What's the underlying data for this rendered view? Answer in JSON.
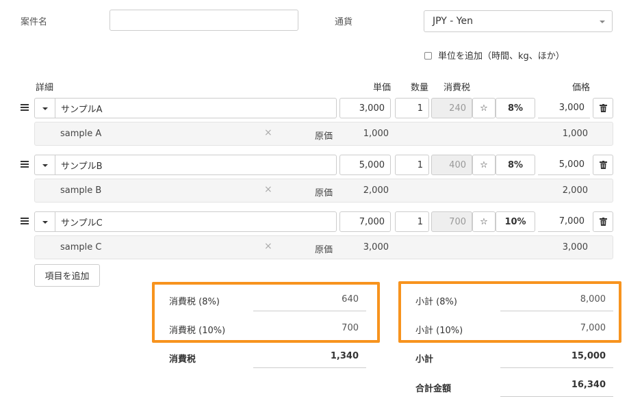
{
  "form": {
    "project_name_label": "案件名",
    "project_name_value": "",
    "currency_label": "通貨",
    "currency_value": "JPY - Yen",
    "unit_checkbox_label": "単位を追加（時間、kg、ほか）"
  },
  "table": {
    "headers": {
      "detail": "詳細",
      "unit_price": "単価",
      "qty": "数量",
      "tax": "消費税",
      "price": "価格"
    },
    "cost_label": "原価",
    "rows": [
      {
        "name": "サンプルA",
        "unit_price": "3,000",
        "qty": "1",
        "tax": "240",
        "tax_rate": "8%",
        "price": "3,000",
        "note": "sample A",
        "cost": "1,000",
        "cost_price": "1,000"
      },
      {
        "name": "サンプルB",
        "unit_price": "5,000",
        "qty": "1",
        "tax": "400",
        "tax_rate": "8%",
        "price": "5,000",
        "note": "sample B",
        "cost": "2,000",
        "cost_price": "2,000"
      },
      {
        "name": "サンプルC",
        "unit_price": "7,000",
        "qty": "1",
        "tax": "700",
        "tax_rate": "10%",
        "price": "7,000",
        "note": "sample C",
        "cost": "3,000",
        "cost_price": "3,000"
      }
    ],
    "add_item_label": "項目を追加"
  },
  "totals": {
    "tax8_label": "消費税 (8%)",
    "tax8_value": "640",
    "tax10_label": "消費税 (10%)",
    "tax10_value": "700",
    "tax_total_label": "消費税",
    "tax_total_value": "1,340",
    "sub8_label": "小計 (8%)",
    "sub8_value": "8,000",
    "sub10_label": "小計 (10%)",
    "sub10_value": "7,000",
    "sub_total_label": "小計",
    "sub_total_value": "15,000",
    "grand_total_label": "合計金額",
    "grand_total_value": "16,340"
  },
  "colors": {
    "highlight": "#f7931e"
  }
}
